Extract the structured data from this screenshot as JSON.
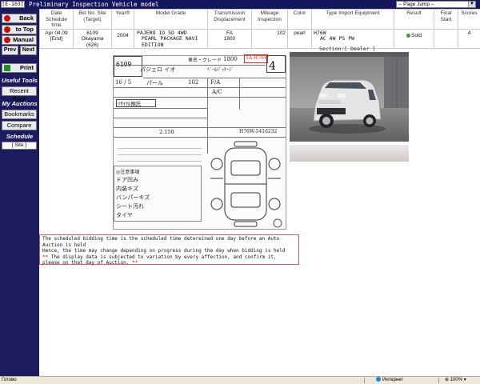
{
  "topbar": {
    "code": "[E-103]",
    "title": "Preliminary Inspection Vehicle model",
    "page_jump": "-- Page Jump --"
  },
  "sidebar": {
    "back": "Back",
    "to_top": "to Top",
    "manual": "Manual",
    "prev": "Prev",
    "next": "Next",
    "print": "Print",
    "useful_tools": "Useful Tools",
    "recent_price": "Recent Price",
    "my_auctions": "My Auctions",
    "bookmarks": "Bookmarks",
    "compare": "Compare",
    "schedule": "Schedule",
    "site": "[ Site ]"
  },
  "table": {
    "headers": {
      "date": "Date Schedule time",
      "bid_no": "Bid No. Site (Target)",
      "year": "Year®",
      "model": "Model Grade",
      "transmission": "Transmission Displacement",
      "mileage": "Mileage Inspection",
      "color": "Color",
      "type": "Type Import Equipment",
      "result": "Result",
      "final": "Final Start",
      "scores": "Scores"
    },
    "row": {
      "date": "Apr 04.09",
      "status": "[End]",
      "bid_no": "6109",
      "site": "Okayama",
      "target": "(626)",
      "year": "2004",
      "model": "PAJERO IO 5D 4WD",
      "grade": "PEARL PACKAGE NAVI EDITION",
      "transmission": "FA",
      "displacement": "1800",
      "mileage": "102",
      "color": "pearl",
      "type": "H76W",
      "equipment": "AC AW PS PW",
      "result": "Sold",
      "final": "",
      "scores": "4"
    }
  },
  "section": "Section:[ Dealer ]",
  "sheet": {
    "lot": "6109",
    "grade": "4",
    "displacement": "1800",
    "chassis": "TA-H76W",
    "model_hw": "パジェロ イオ",
    "date_hw": "16 / 5",
    "color_hw": "パール",
    "mileage_hw": "102",
    "trans_hw": "F/A",
    "ac_hw": "A/C",
    "serial": "H76W-5416232",
    "recycle": "2.150",
    "line1": "ドア凹み",
    "line2": "内装キズ",
    "line3": "バンパーキズ",
    "line4": "シート汚れ",
    "line5": "タイヤ"
  },
  "notice": {
    "line1": "The scheduled bidding time is the scheduled time detereined one day before an Auto Auction is held",
    "line2": "Hence, the time may change depending on progress during the day when bidding is held",
    "line3_mark": "**",
    "line3": " The display data is subjected to variation by every affection, and confirm it, please on that day of Auction. ",
    "line3_end": "**"
  },
  "status": {
    "ready": "Готово",
    "zone": "Интернет",
    "zoom": "100%"
  },
  "colors": {
    "navy": "#16165e",
    "sold": "#2ea530",
    "notice_red": "#cc1111"
  }
}
